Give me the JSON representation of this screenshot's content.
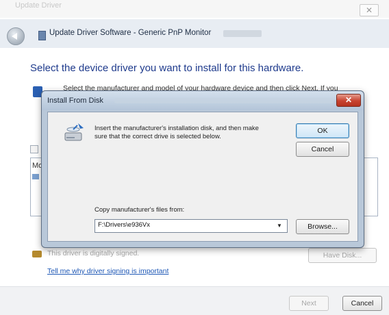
{
  "outer": {
    "close_label": "✕",
    "top_hint": "Update Driver"
  },
  "wizard": {
    "title": "Update Driver Software - Generic PnP Monitor",
    "heading": "Select the device driver you want to install for this hardware.",
    "instruction": "Select the manufacturer and model of your hardware device and then click Next. If you",
    "list_label": "Mo",
    "unsigned_text": "This driver is digitally signed.",
    "have_disk_label": "Have Disk...",
    "signing_link": "Tell me why driver signing is important",
    "next_label": "Next",
    "cancel_label": "Cancel"
  },
  "dialog": {
    "title": "Install From Disk",
    "close_label": "✕",
    "message": "Insert the manufacturer's installation disk, and then make sure that the correct drive is selected below.",
    "ok_label": "OK",
    "cancel_label": "Cancel",
    "copy_label": "Copy manufacturer's files from:",
    "path_value": "F:\\Drivers\\e936Vx",
    "browse_label": "Browse..."
  }
}
